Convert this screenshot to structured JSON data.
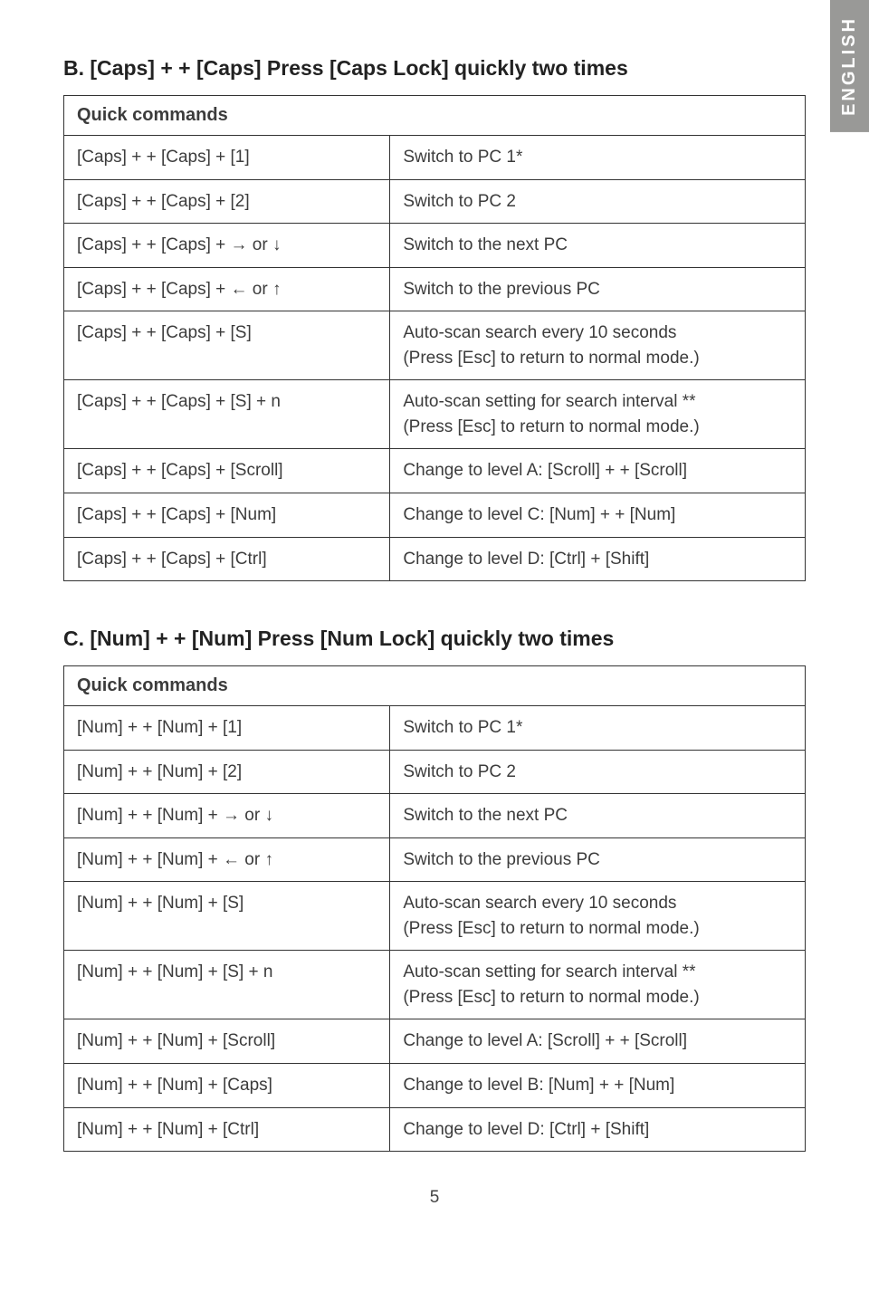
{
  "lang_tab": "ENGLISH",
  "page_number": "5",
  "section_b": {
    "title": "B. [Caps] + + [Caps] Press [Caps Lock] quickly two times",
    "header": "Quick commands",
    "rows": [
      {
        "key": "[Caps] + + [Caps] + [1]",
        "desc": "Switch to PC 1*"
      },
      {
        "key": "[Caps] + + [Caps] + [2]",
        "desc": "Switch to PC 2"
      },
      {
        "key": "[Caps] + + [Caps] + → or ↓",
        "desc": "Switch to the next PC"
      },
      {
        "key": "[Caps] + + [Caps] + ← or ↑",
        "desc": "Switch to the previous PC"
      },
      {
        "key": "[Caps] + + [Caps] + [S]",
        "desc": "Auto-scan search every 10 seconds\n(Press [Esc] to return to normal mode.)"
      },
      {
        "key": "[Caps] + + [Caps] + [S] + n",
        "desc": "Auto-scan setting for search interval **\n(Press [Esc] to return to normal mode.)"
      },
      {
        "key": "[Caps] + + [Caps] + [Scroll]",
        "desc": "Change to level A: [Scroll] + + [Scroll]"
      },
      {
        "key": "[Caps] + + [Caps] + [Num]",
        "desc": "Change to level C: [Num] + + [Num]"
      },
      {
        "key": "[Caps] + + [Caps] + [Ctrl]",
        "desc": "Change to level D: [Ctrl] + [Shift]"
      }
    ]
  },
  "section_c": {
    "title": "C. [Num] + + [Num] Press [Num Lock] quickly two times",
    "header": "Quick commands",
    "rows": [
      {
        "key": "[Num] + + [Num] + [1]",
        "desc": "Switch to PC 1*"
      },
      {
        "key": "[Num] + + [Num] + [2]",
        "desc": "Switch to PC 2"
      },
      {
        "key": "[Num] + + [Num] + → or ↓",
        "desc": "Switch to the next PC"
      },
      {
        "key": "[Num] + + [Num] + ← or ↑",
        "desc": "Switch to the previous PC"
      },
      {
        "key": "[Num] + + [Num] + [S]",
        "desc": "Auto-scan search every 10 seconds\n(Press [Esc] to return to normal mode.)"
      },
      {
        "key": "[Num] + + [Num] + [S] + n",
        "desc": "Auto-scan setting for search interval **\n(Press [Esc] to return to normal mode.)"
      },
      {
        "key": "[Num] + + [Num] + [Scroll]",
        "desc": "Change to level A: [Scroll] + + [Scroll]"
      },
      {
        "key": "[Num] + + [Num] + [Caps]",
        "desc": "Change to level B: [Num] + + [Num]"
      },
      {
        "key": "[Num] + + [Num] + [Ctrl]",
        "desc": "Change to level D: [Ctrl] + [Shift]"
      }
    ]
  }
}
